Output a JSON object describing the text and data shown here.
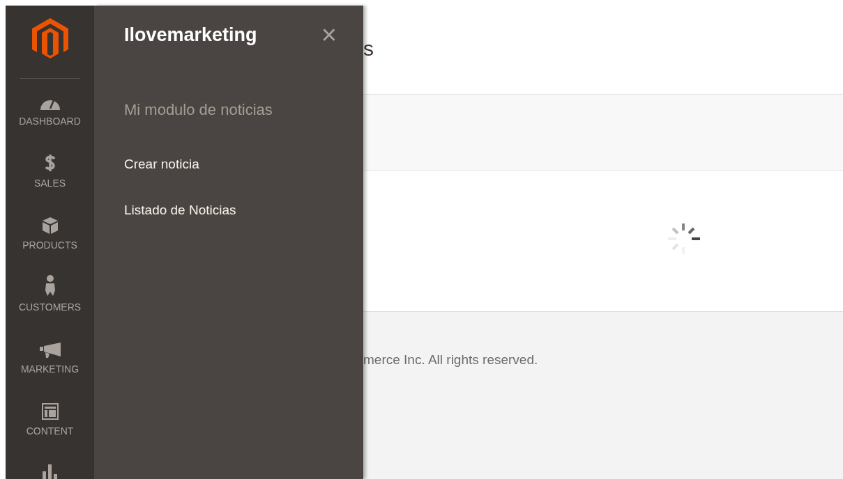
{
  "nav": {
    "items": [
      {
        "kind": "dashboard",
        "label": "DASHBOARD"
      },
      {
        "kind": "sales",
        "label": "SALES"
      },
      {
        "kind": "products",
        "label": "PRODUCTS"
      },
      {
        "kind": "customers",
        "label": "CUSTOMERS"
      },
      {
        "kind": "marketing",
        "label": "MARKETING"
      },
      {
        "kind": "content",
        "label": "CONTENT"
      },
      {
        "kind": "reports"
      }
    ]
  },
  "flyout": {
    "title": "Ilovemarketing",
    "close": "×",
    "section": "Mi modulo de noticias",
    "links": [
      "Crear noticia",
      "Listado de Noticias"
    ]
  },
  "page": {
    "title": "s",
    "footer": "merce Inc. All rights reserved."
  }
}
